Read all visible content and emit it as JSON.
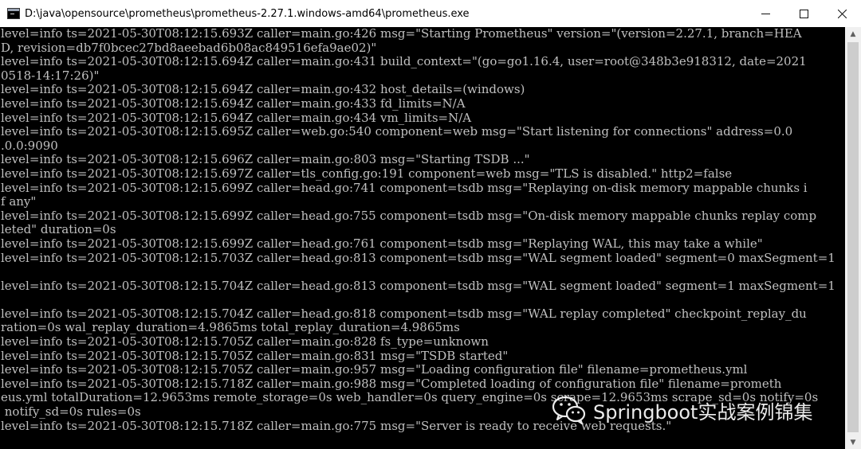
{
  "window": {
    "title": "D:\\java\\opensource\\prometheus\\prometheus-2.27.1.windows-amd64\\prometheus.exe",
    "controls": [
      "minimize-icon",
      "maximize-icon",
      "close-icon"
    ]
  },
  "console": {
    "lines": [
      "level=info ts=2021-05-30T08:12:15.693Z caller=main.go:426 msg=\"Starting Prometheus\" version=\"(version=2.27.1, branch=HEA",
      "D, revision=db7f0bcec27bd8aeebad6b08ac849516efa9ae02)\"",
      "level=info ts=2021-05-30T08:12:15.694Z caller=main.go:431 build_context=\"(go=go1.16.4, user=root@348b3e918312, date=2021",
      "0518-14:17:26)\"",
      "level=info ts=2021-05-30T08:12:15.694Z caller=main.go:432 host_details=(windows)",
      "level=info ts=2021-05-30T08:12:15.694Z caller=main.go:433 fd_limits=N/A",
      "level=info ts=2021-05-30T08:12:15.694Z caller=main.go:434 vm_limits=N/A",
      "level=info ts=2021-05-30T08:12:15.695Z caller=web.go:540 component=web msg=\"Start listening for connections\" address=0.0",
      ".0.0:9090",
      "level=info ts=2021-05-30T08:12:15.696Z caller=main.go:803 msg=\"Starting TSDB ...\"",
      "level=info ts=2021-05-30T08:12:15.697Z caller=tls_config.go:191 component=web msg=\"TLS is disabled.\" http2=false",
      "level=info ts=2021-05-30T08:12:15.699Z caller=head.go:741 component=tsdb msg=\"Replaying on-disk memory mappable chunks i",
      "f any\"",
      "level=info ts=2021-05-30T08:12:15.699Z caller=head.go:755 component=tsdb msg=\"On-disk memory mappable chunks replay comp",
      "leted\" duration=0s",
      "level=info ts=2021-05-30T08:12:15.699Z caller=head.go:761 component=tsdb msg=\"Replaying WAL, this may take a while\"",
      "level=info ts=2021-05-30T08:12:15.703Z caller=head.go:813 component=tsdb msg=\"WAL segment loaded\" segment=0 maxSegment=1",
      "",
      "level=info ts=2021-05-30T08:12:15.704Z caller=head.go:813 component=tsdb msg=\"WAL segment loaded\" segment=1 maxSegment=1",
      "",
      "level=info ts=2021-05-30T08:12:15.704Z caller=head.go:818 component=tsdb msg=\"WAL replay completed\" checkpoint_replay_du",
      "ration=0s wal_replay_duration=4.9865ms total_replay_duration=4.9865ms",
      "level=info ts=2021-05-30T08:12:15.705Z caller=main.go:828 fs_type=unknown",
      "level=info ts=2021-05-30T08:12:15.705Z caller=main.go:831 msg=\"TSDB started\"",
      "level=info ts=2021-05-30T08:12:15.705Z caller=main.go:957 msg=\"Loading configuration file\" filename=prometheus.yml",
      "level=info ts=2021-05-30T08:12:15.718Z caller=main.go:988 msg=\"Completed loading of configuration file\" filename=prometh",
      "eus.yml totalDuration=12.9653ms remote_storage=0s web_handler=0s query_engine=0s scrape=12.9653ms scrape_sd=0s notify=0s",
      " notify_sd=0s rules=0s",
      "level=info ts=2021-05-30T08:12:15.718Z caller=main.go:775 msg=\"Server is ready to receive web requests.\""
    ]
  },
  "watermark": {
    "icon": "wechat-icon",
    "text": "Springboot实战案例锦集"
  },
  "colors": {
    "console_bg": "#000000",
    "console_text": "#c0c0c0",
    "titlebar_bg": "#ffffff"
  }
}
